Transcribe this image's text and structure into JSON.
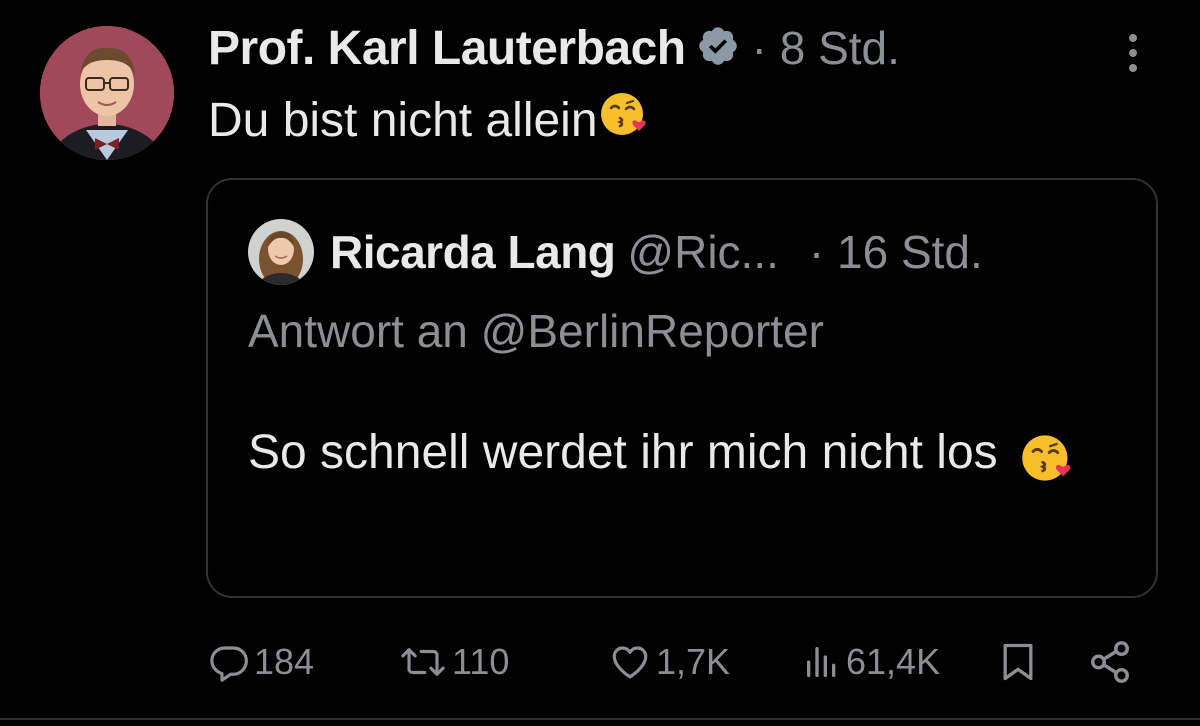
{
  "tweet": {
    "display_name": "Prof. Karl Lauterbach",
    "dot_time": "· 8 Std.",
    "text": "Du bist nicht allein",
    "text_emoji": "face-throwing-a-kiss-emoji"
  },
  "quote": {
    "display_name": "Ricarda Lang",
    "handle": "@Ric...",
    "dot_time": "· 16 Std.",
    "reply_to": "Antwort an @BerlinReporter",
    "text": "So schnell werdet ihr mich nicht los",
    "text_emoji": "face-throwing-a-kiss-emoji"
  },
  "actions": {
    "replies": "184",
    "retweets": "110",
    "likes": "1,7K",
    "views": "61,4K"
  },
  "icons": {
    "verified": "verified-badge-icon",
    "more": "more-dots-icon",
    "reply": "reply-icon",
    "retweet": "retweet-icon",
    "like": "heart-icon",
    "views": "views-bar-chart-icon",
    "bookmark": "bookmark-icon",
    "share": "share-icon"
  },
  "colors": {
    "background": "#000000",
    "text_primary": "#e7e9ea",
    "text_secondary": "#8b8f94",
    "border": "#2f3336",
    "verified_badge": "#8b98a5"
  }
}
